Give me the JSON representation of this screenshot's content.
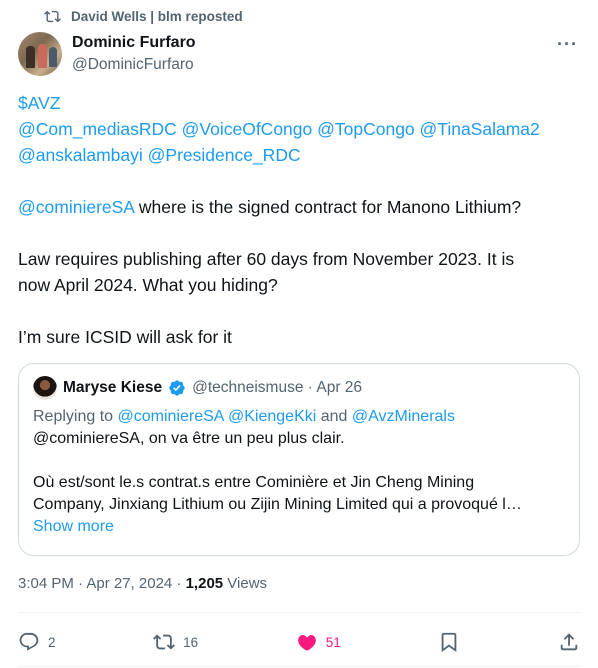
{
  "repost": {
    "text": "David Wells | blm reposted",
    "icon": "repost-icon"
  },
  "author": {
    "name": "Dominic Furfaro",
    "handle": "@DominicFurfaro"
  },
  "more_label": "···",
  "tweet": {
    "line1": "$AVZ",
    "line2": "@Com_mediasRDC @VoiceOfCongo @TopCongo @TinaSalama2",
    "line3": "@anskalambayi @Presidence_RDC",
    "line4_mention": "@cominiereSA",
    "line4_rest": " where is the signed contract for Manono Lithium?",
    "line5": "Law requires publishing after 60 days from November 2023. It is",
    "line6": "now April 2024. What you hiding?",
    "line7": "I’m sure ICSID will ask for it"
  },
  "quote": {
    "name": "Maryse Kiese",
    "handle_time": "@techneismuse · Apr 26",
    "replying_prefix": "Replying to ",
    "replying_to": "@cominiereSA @KiengeKki",
    "replying_and": " and ",
    "replying_last": "@AvzMinerals",
    "line1": "@cominiereSA, on va être un peu plus clair.",
    "line2": "Où est/sont le.s contrat.s entre Cominière et Jin Cheng Mining",
    "line3": "Company, Jinxiang Lithium ou Zijin Mining Limited qui a provoqué l…",
    "show_more": "Show more"
  },
  "meta": {
    "time": "3:04 PM · Apr 27, 2024 · ",
    "views_count": "1,205",
    "views_label": " Views"
  },
  "actions": {
    "replies": "2",
    "reposts": "16",
    "likes": "51"
  },
  "colors": {
    "accent": "#1d9bf0",
    "like": "#f91880",
    "text": "#0f1419",
    "muted": "#536471",
    "border": "#cfd9de"
  }
}
